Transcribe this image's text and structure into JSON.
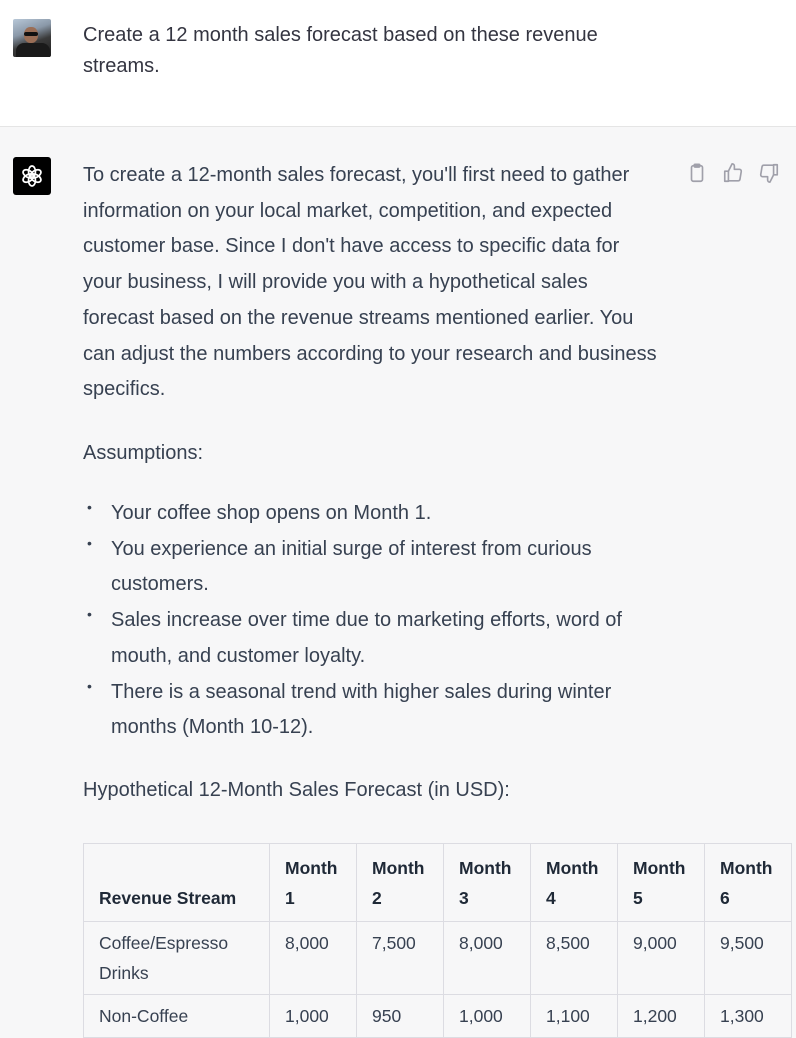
{
  "user_message": {
    "avatar": "user-avatar-photo",
    "text": "Create a 12 month sales forecast based on these revenue streams."
  },
  "assistant_message": {
    "logo": "openai-logo-icon",
    "actions": [
      {
        "name": "copy-button",
        "icon": "clipboard-icon"
      },
      {
        "name": "thumbs-up-button",
        "icon": "thumbs-up-icon"
      },
      {
        "name": "thumbs-down-button",
        "icon": "thumbs-down-icon"
      }
    ],
    "intro": "To create a 12-month sales forecast, you'll first need to gather information on your local market, competition, and expected customer base. Since I don't have access to specific data for your business, I will provide you with a hypothetical sales forecast based on the revenue streams mentioned earlier. You can adjust the numbers according to your research and business specifics.",
    "assumptions_heading": "Assumptions:",
    "assumptions": [
      "Your coffee shop opens on Month 1.",
      "You experience an initial surge of interest from curious customers.",
      "Sales increase over time due to marketing efforts, word of mouth, and customer loyalty.",
      "There is a seasonal trend with higher sales during winter months (Month 10-12)."
    ],
    "table_title": "Hypothetical 12-Month Sales Forecast (in USD):",
    "table": {
      "headers": [
        "Revenue Stream",
        "Month 1",
        "Month 2",
        "Month 3",
        "Month 4",
        "Month 5",
        "Month 6"
      ],
      "rows": [
        [
          "Coffee/Espresso Drinks",
          "8,000",
          "7,500",
          "8,000",
          "8,500",
          "9,000",
          "9,500"
        ],
        [
          "Non-Coffee",
          "1,000",
          "950",
          "1,000",
          "1,100",
          "1,200",
          "1,300"
        ]
      ]
    }
  }
}
